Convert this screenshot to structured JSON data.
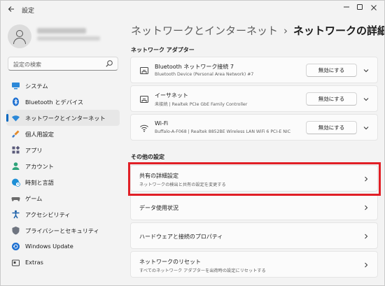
{
  "window": {
    "title": "設定",
    "back_icon": "arrow-left-icon",
    "controls": [
      "minimize",
      "maximize",
      "close"
    ]
  },
  "user": {
    "avatar_icon": "person-icon"
  },
  "search": {
    "placeholder": "設定の検索",
    "icon": "search-icon"
  },
  "sidebar": {
    "items": [
      {
        "label": "システム",
        "icon": "monitor-icon"
      },
      {
        "label": "Bluetooth とデバイス",
        "icon": "bluetooth-icon"
      },
      {
        "label": "ネットワークとインターネット",
        "icon": "wifi-icon",
        "active": true
      },
      {
        "label": "個人用設定",
        "icon": "brush-icon"
      },
      {
        "label": "アプリ",
        "icon": "apps-icon"
      },
      {
        "label": "アカウント",
        "icon": "person-icon"
      },
      {
        "label": "時刻と言語",
        "icon": "globe-clock-icon"
      },
      {
        "label": "ゲーム",
        "icon": "gamepad-icon"
      },
      {
        "label": "アクセシビリティ",
        "icon": "accessibility-icon"
      },
      {
        "label": "プライバシーとセキュリティ",
        "icon": "shield-icon"
      },
      {
        "label": "Windows Update",
        "icon": "update-icon"
      },
      {
        "label": "Extras",
        "icon": "extras-icon"
      }
    ]
  },
  "breadcrumb": {
    "parent": "ネットワークとインターネット",
    "separator": "›",
    "current": "ネットワークの詳細設定"
  },
  "adapters": {
    "section_title": "ネットワーク アダプター",
    "items": [
      {
        "name": "Bluetooth ネットワーク接続 7",
        "detail": "Bluetooth Device (Personal Area Network) #7",
        "button": "無効にする",
        "icon": "ethernet-port-icon"
      },
      {
        "name": "イーサネット",
        "detail": "未接続 | Realtek PCIe GbE Family Controller",
        "button": "無効にする",
        "icon": "ethernet-port-icon"
      },
      {
        "name": "Wi-Fi",
        "detail": "Buffalo-A-F068 | Realtek 8852BE Wireless LAN WiFi 6 PCI-E NIC",
        "button": "無効にする",
        "icon": "wifi-icon"
      }
    ]
  },
  "other": {
    "section_title": "その他の設定",
    "items": [
      {
        "title": "共有の詳細設定",
        "subtitle": "ネットワークの検出と共有の設定を変更する",
        "highlighted": true
      },
      {
        "title": "データ使用状況",
        "subtitle": ""
      },
      {
        "title": "ハードウェアと接続のプロパティ",
        "subtitle": ""
      },
      {
        "title": "ネットワークのリセット",
        "subtitle": "すべてのネットワーク アダプターを出荷時の設定にリセットする"
      }
    ]
  },
  "colors": {
    "accent": "#0067c0",
    "highlight_box": "#e11f26",
    "background": "#f3f3f3",
    "card": "#fbfbfb"
  }
}
